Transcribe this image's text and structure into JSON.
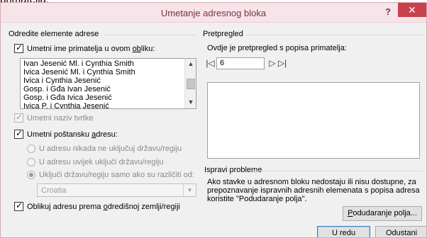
{
  "background_caption": "primatelja.",
  "dialog": {
    "title": "Umetanje adresnog bloka",
    "help": "?",
    "close": "✕"
  },
  "left": {
    "section_title": "Odredite elemente adrese",
    "insert_name": {
      "label_prefix": "Umetni ime primatelja u ovom ",
      "label_underlined": "ob",
      "label_suffix": "liku:",
      "checked": true
    },
    "name_formats": [
      "Ivan Jesenić Ml. i Cynthia Smith",
      "Ivica Jesenić Ml. i Cynthia Smith",
      "Ivica i Cynthia Jesenić",
      "Gosp. i Gđa Ivan Jesenić",
      "Gosp. i Gđa Ivica Jesenić",
      "Ivica P. i Cynthia Jesenić"
    ],
    "insert_company": {
      "label": "Umetni naziv tvrtke",
      "checked": true,
      "enabled": false
    },
    "insert_postal": {
      "label_prefix": "Umetni poštansku ",
      "label_underlined": "a",
      "label_suffix": "dresu:",
      "checked": true
    },
    "country_options": [
      "U adresu nikada ne uključuj državu/regiju",
      "U adresu uvijek uključi državu/regiju",
      "Uključi državu/regiju samo ako su različiti od:"
    ],
    "country_selected_index": 2,
    "country_value": "Croatia",
    "format_by_country": {
      "label_prefix": "Oblikuj adresu prema ",
      "label_underlined": "o",
      "label_suffix": "dredišnoj zemlji/regiji",
      "checked": true
    }
  },
  "right": {
    "preview_title": "Pretpregled",
    "preview_hint": "Ovdje je pretpregled s popisa primatelja:",
    "nav": {
      "first_icon": "first-record-icon",
      "prev_icon": "previous-record-icon",
      "next_icon": "next-record-icon",
      "last_icon": "last-record-icon",
      "record_number": "6"
    },
    "fix_title": "Ispravi probleme",
    "fix_text": "Ako stavke u adresnom bloku nedostaju ili nisu dostupne, za prepoznavanje ispravnih adresnih elemenata s popisa adresa koristite \"Podudaranje polja\".",
    "match_fields_underlined": "P",
    "match_fields_rest": "odudaranje polja..."
  },
  "buttons": {
    "ok": "U redu",
    "cancel": "Odustani"
  },
  "colors": {
    "title_bar": "#f6e4e9",
    "title_text": "#7a3344",
    "close_button": "#c8414d",
    "dialog_bg": "#f0f0f0"
  }
}
